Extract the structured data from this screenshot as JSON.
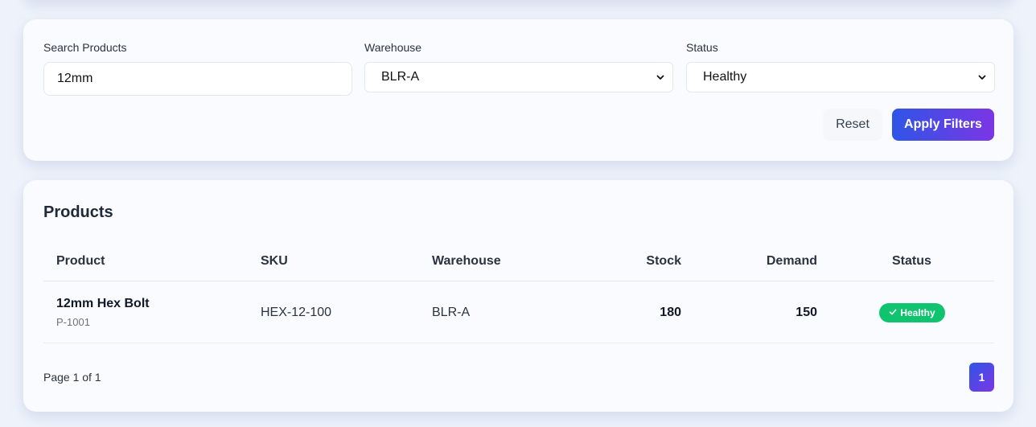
{
  "filters": {
    "search_label": "Search Products",
    "search_value": "12mm",
    "warehouse_label": "Warehouse",
    "warehouse_value": "BLR-A",
    "status_label": "Status",
    "status_value": "Healthy",
    "reset_label": "Reset",
    "apply_label": "Apply Filters"
  },
  "products": {
    "title": "Products",
    "columns": [
      "Product",
      "SKU",
      "Warehouse",
      "Stock",
      "Demand",
      "Status"
    ],
    "rows": [
      {
        "name": "12mm Hex Bolt",
        "id": "P-1001",
        "sku": "HEX-12-100",
        "warehouse": "BLR-A",
        "stock": "180",
        "demand": "150",
        "status": "Healthy",
        "status_icon": "check-icon"
      }
    ],
    "status_color": "#10c46f"
  },
  "pagination": {
    "info": "Page 1 of 1",
    "current": "1"
  },
  "colors": {
    "accent_start": "#2f55e6",
    "accent_end": "#7b36e4"
  }
}
